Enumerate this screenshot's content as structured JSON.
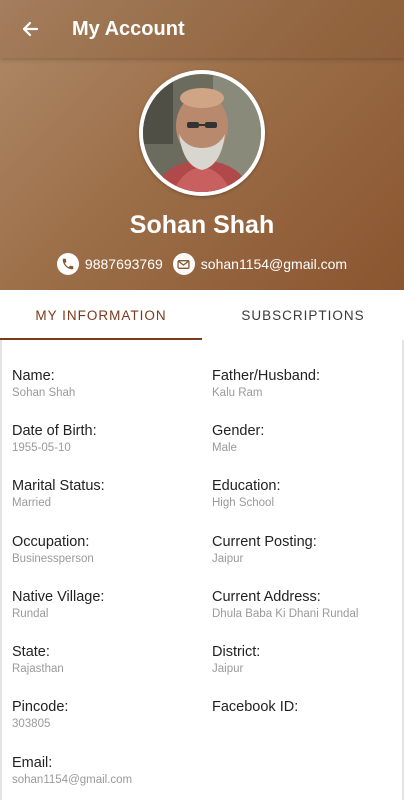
{
  "appbar": {
    "title": "My Account",
    "back_icon": "arrow-left-icon"
  },
  "profile": {
    "name": "Sohan Shah",
    "phone": "9887693769",
    "email": "sohan1154@gmail.com",
    "phone_icon": "phone-icon",
    "email_icon": "mail-icon"
  },
  "tabs": [
    {
      "label": "MY INFORMATION",
      "active": true
    },
    {
      "label": "SUBSCRIPTIONS",
      "active": false
    }
  ],
  "info": {
    "name": {
      "label": "Name:",
      "value": "Sohan Shah"
    },
    "father_husband": {
      "label": "Father/Husband:",
      "value": "Kalu Ram"
    },
    "dob": {
      "label": "Date of Birth:",
      "value": "1955-05-10"
    },
    "gender": {
      "label": "Gender:",
      "value": "Male"
    },
    "marital_status": {
      "label": "Marital Status:",
      "value": "Married"
    },
    "education": {
      "label": "Education:",
      "value": "High School"
    },
    "occupation": {
      "label": "Occupation:",
      "value": "Businessperson"
    },
    "current_posting": {
      "label": "Current Posting:",
      "value": "Jaipur"
    },
    "native_village": {
      "label": "Native Village:",
      "value": "Rundal"
    },
    "current_address": {
      "label": "Current Address:",
      "value": "Dhula Baba Ki Dhani Rundal"
    },
    "state": {
      "label": "State:",
      "value": "Rajasthan"
    },
    "district": {
      "label": "District:",
      "value": "Jaipur"
    },
    "pincode": {
      "label": "Pincode:",
      "value": "303805"
    },
    "facebook_id": {
      "label": "Facebook ID:",
      "value": ""
    },
    "email": {
      "label": "Email:",
      "value": "sohan1154@gmail.com"
    }
  },
  "colors": {
    "accent": "#7a3a1c",
    "hero_start": "#b08a6a",
    "hero_end": "#8a5530"
  }
}
